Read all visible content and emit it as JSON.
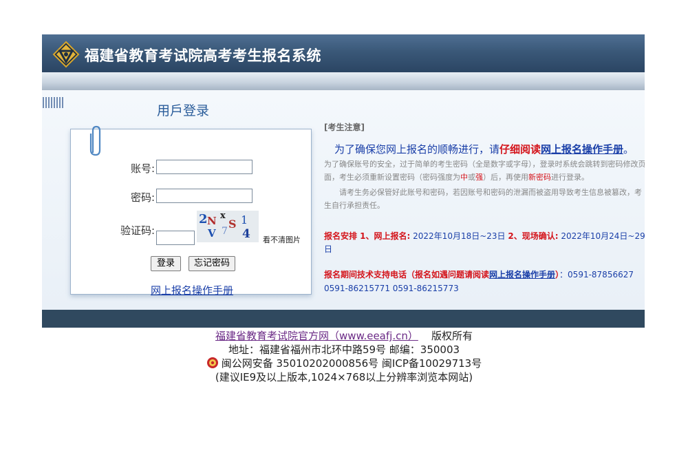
{
  "header": {
    "title": "福建省教育考试院高考考生报名系统",
    "logo_icon": "compass-logo-icon"
  },
  "login": {
    "title": "用戶登录",
    "account_label": "账号:",
    "password_label": "密码:",
    "captcha_label": "验证码:",
    "account_value": "",
    "password_value": "",
    "captcha_value": "",
    "captcha_chars": [
      "2",
      "N",
      "x",
      "S",
      "1",
      "V",
      "7",
      "4"
    ],
    "refresh_text": "看不清图片",
    "login_button": "登录",
    "forgot_button": "忘记密码",
    "manual_link": "网上报名操作手册"
  },
  "notice": {
    "heading": "[考生注意]",
    "lead_part1": "为了确保您网上报名的顺畅进行，请",
    "lead_red": "仔细阅读",
    "lead_link": "网上报名操作手册",
    "lead_end": "。",
    "p1_a": "为了确保账号的安全，过于简单的考生密码（全是数字或字母），登录时系统会跳转到密码修改页面，考生必须重新设置密码（密码强度为",
    "p1_mid": "中",
    "p1_or": "或",
    "p1_strong": "强",
    "p1_b": "）后，再使用",
    "p1_new": "新密码",
    "p1_c": "进行登录。",
    "p2": "请考生务必保管好此账号和密码，若因账号和密码的泄漏而被盗用导致考生信息被篡改，考生自行承担责任。",
    "schedule_label1": "报名安排 1、网上报名:",
    "schedule_date1": " 2022年10月18日~23日 ",
    "schedule_label2": "2、现场确认:",
    "schedule_date2": " 2022年10月24日~29日",
    "support_label": "报名期间技术支持电话（报名如遇问题请阅读",
    "support_link": "网上报名操作手册",
    "support_close": "）",
    "support_phone1": "：0591-87856627",
    "support_phone2": "0591-86215771   0591-86215773"
  },
  "footer": {
    "site_link": "福建省教育考试院官方网（www.eeafj.cn）",
    "copyright": "版权所有",
    "address": "地址：福建省福州市北环中路59号 邮编：350003",
    "police_icon": "police-badge-icon",
    "beian": "闽公网安备 35010202000856号  闽ICP备10029713号",
    "browser_note": "(建议IE9及以上版本,1024×768以上分辨率浏览本网站)"
  },
  "colors": {
    "banner": "#3a5878",
    "link_blue": "#1a3fa8",
    "alert_red": "#d4141b",
    "footer_link": "#6b2a86"
  }
}
